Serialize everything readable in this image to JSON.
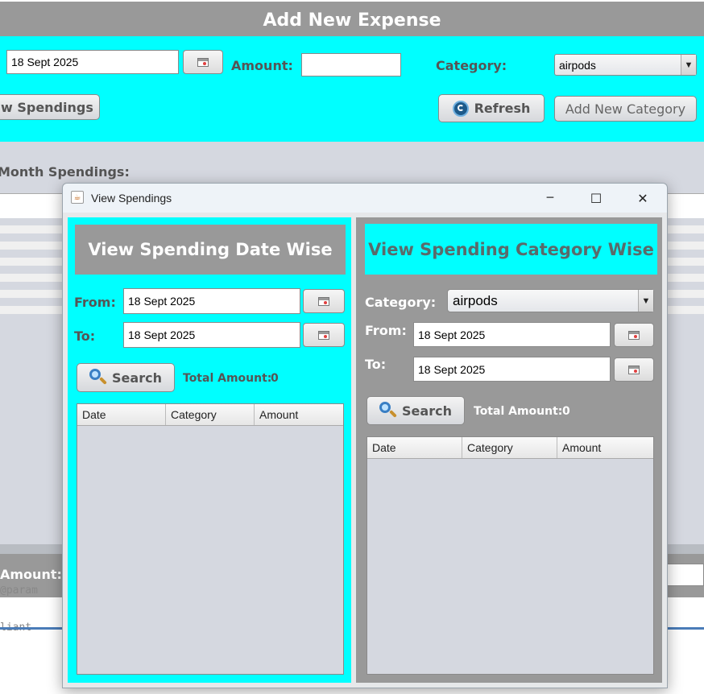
{
  "main_window": {
    "title": "Add New Expense",
    "date_value": "18 Sept 2025",
    "amount_label": "Amount:",
    "amount_value": "",
    "category_label": "Category:",
    "category_value": "airpods",
    "view_spendings_button": "w Spendings",
    "refresh_button": "Refresh",
    "add_category_button": "Add New Category",
    "month_spendings_label": "Month Spendings:",
    "total_amount_label": "Amount:",
    "code_snippet_1": "@param",
    "code_snippet_2": "liant"
  },
  "dialog": {
    "title": "View Spendings",
    "minimize_glyph": "─",
    "maximize_glyph": "☐",
    "close_glyph": "✕",
    "left_panel": {
      "header": "View Spending Date Wise",
      "from_label": "From:",
      "from_value": "18 Sept 2025",
      "to_label": "To:",
      "to_value": "18 Sept 2025",
      "search_button": "Search",
      "total_label": "Total Amount:",
      "total_value": "0",
      "columns": [
        "Date",
        "Category",
        "Amount"
      ]
    },
    "right_panel": {
      "header": "View Spending Category Wise",
      "category_label": "Category:",
      "category_value": "airpods",
      "from_label": "From:",
      "from_value": "18 Sept 2025",
      "to_label": "To:",
      "to_value": "18 Sept 2025",
      "search_button": "Search",
      "total_label": "Total Amount:",
      "total_value": "0",
      "columns": [
        "Date",
        "Category",
        "Amount"
      ]
    }
  },
  "colors": {
    "cyan": "#00ffff",
    "gray_header": "#999999",
    "table_bg": "#d5d8e0"
  }
}
